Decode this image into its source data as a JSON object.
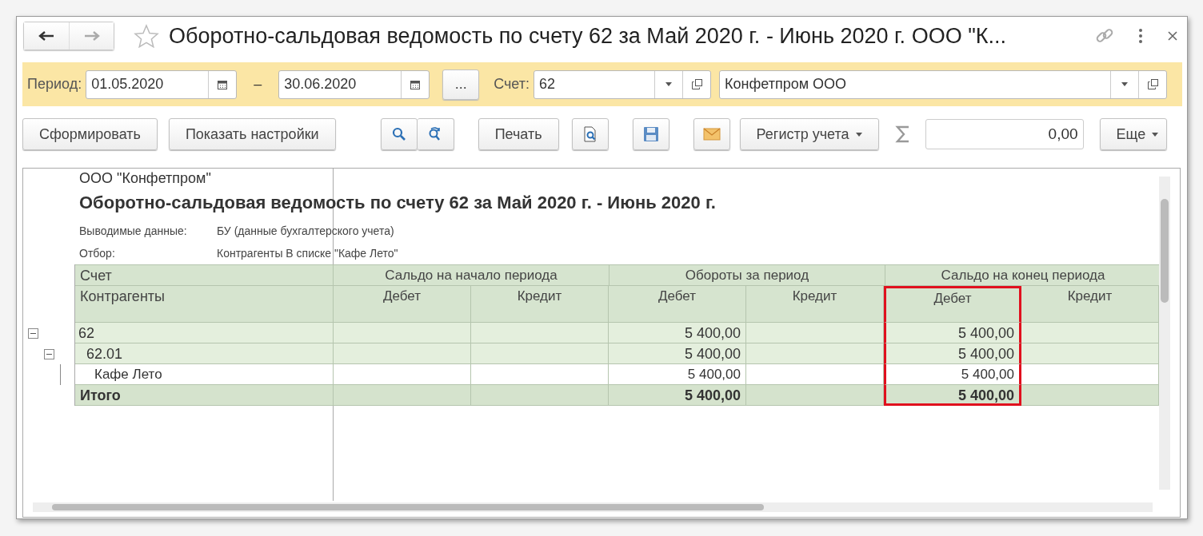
{
  "window": {
    "title": "Оборотно-сальдовая ведомость по счету 62 за Май 2020 г. - Июнь 2020 г. ООО \"К..."
  },
  "filters": {
    "period_label": "Период:",
    "date_from": "01.05.2020",
    "separator": "–",
    "date_to": "30.06.2020",
    "more_button": "...",
    "account_label": "Счет:",
    "account": "62",
    "organization": "Конфетпром ООО"
  },
  "toolbar": {
    "generate": "Сформировать",
    "settings": "Показать настройки",
    "print": "Печать",
    "register": "Регистр учета",
    "sum": "0,00",
    "more": "Еще"
  },
  "report": {
    "organization": "ООО \"Конфетпром\"",
    "title": "Оборотно-сальдовая ведомость по счету 62 за Май 2020 г. - Июнь 2020 г.",
    "info": [
      {
        "label": "Выводимые данные:",
        "value": "БУ (данные бухгалтерского учета)"
      },
      {
        "label": "Отбор:",
        "value": "Контрагенты В списке \"Кафе Лето\""
      }
    ],
    "header": {
      "column_1": "Счет",
      "column_1_sub": "Контрагенты",
      "groups": [
        "Сальдо на начало периода",
        "Обороты за период",
        "Сальдо на конец периода"
      ],
      "subcolumns": [
        {
          "label": "Дебет",
          "highlighted": false
        },
        {
          "label": "Кредит",
          "highlighted": false
        },
        {
          "label": "Дебет",
          "highlighted": false
        },
        {
          "label": "Кредит",
          "highlighted": false
        },
        {
          "label": "Дебет",
          "highlighted": true
        },
        {
          "label": "Кредит",
          "highlighted": false
        }
      ]
    },
    "rows": [
      {
        "label": "62",
        "kind": "account",
        "expanded": true,
        "values": {
          "turnover_debit": "5 400,00",
          "closing_debit": "5 400,00"
        },
        "children": [
          {
            "label": "62.01",
            "kind": "account",
            "expanded": true,
            "values": {
              "turnover_debit": "5 400,00",
              "closing_debit": "5 400,00"
            },
            "children": [
              {
                "label": "Кафе Лето",
                "kind": "counterparty",
                "values": {
                  "turnover_debit": "5 400,00",
                  "closing_debit": "5 400,00"
                }
              }
            ]
          }
        ]
      }
    ],
    "total": {
      "label": "Итого",
      "values": {
        "turnover_debit": "5 400,00",
        "closing_debit": "5 400,00"
      }
    }
  }
}
